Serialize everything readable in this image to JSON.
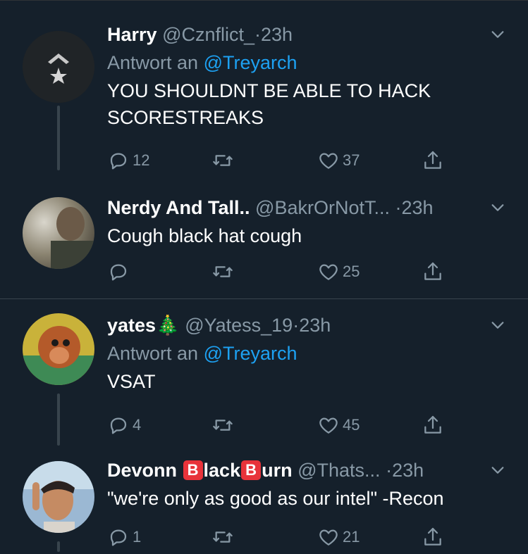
{
  "tweets": [
    {
      "name": "Harry",
      "handle": "@Cznflict_",
      "dot": "·",
      "time": "23h",
      "reply_prefix": "Antwort an",
      "reply_to": "@Treyarch",
      "text": "YOU SHOULDNT BE ABLE TO HACK SCORESTREAKS",
      "replies": "12",
      "retweets": "",
      "likes": "37"
    },
    {
      "name": "Nerdy And Tall..",
      "handle": "@BakrOrNotT...",
      "dot": "·",
      "time": "23h",
      "text": "Cough black hat cough",
      "replies": "",
      "retweets": "",
      "likes": "25"
    },
    {
      "name": "yates",
      "name_emoji": "🎄",
      "handle": "@Yatess_19",
      "dot": "·",
      "time": "23h",
      "reply_prefix": "Antwort an",
      "reply_to": "@Treyarch",
      "text": "VSAT",
      "replies": "4",
      "retweets": "",
      "likes": "45"
    },
    {
      "name_part1": "Devonn",
      "badge1": "B",
      "name_part2": "lack",
      "badge2": "B",
      "name_part3": "urn",
      "handle": "@Thats...",
      "dot": "·",
      "time": "23h",
      "text": "\"we're only as good as our intel\" -Recon",
      "replies": "1",
      "retweets": "",
      "likes": "21"
    }
  ],
  "icons": {
    "reply": "reply-icon",
    "retweet": "retweet-icon",
    "like": "heart-icon",
    "share": "share-icon",
    "more": "chevron-down-icon"
  },
  "colors": {
    "background": "#15202b",
    "secondary_text": "#8899a6",
    "link": "#1da1f2",
    "divider": "#38444d",
    "badge": "#e8333a"
  }
}
